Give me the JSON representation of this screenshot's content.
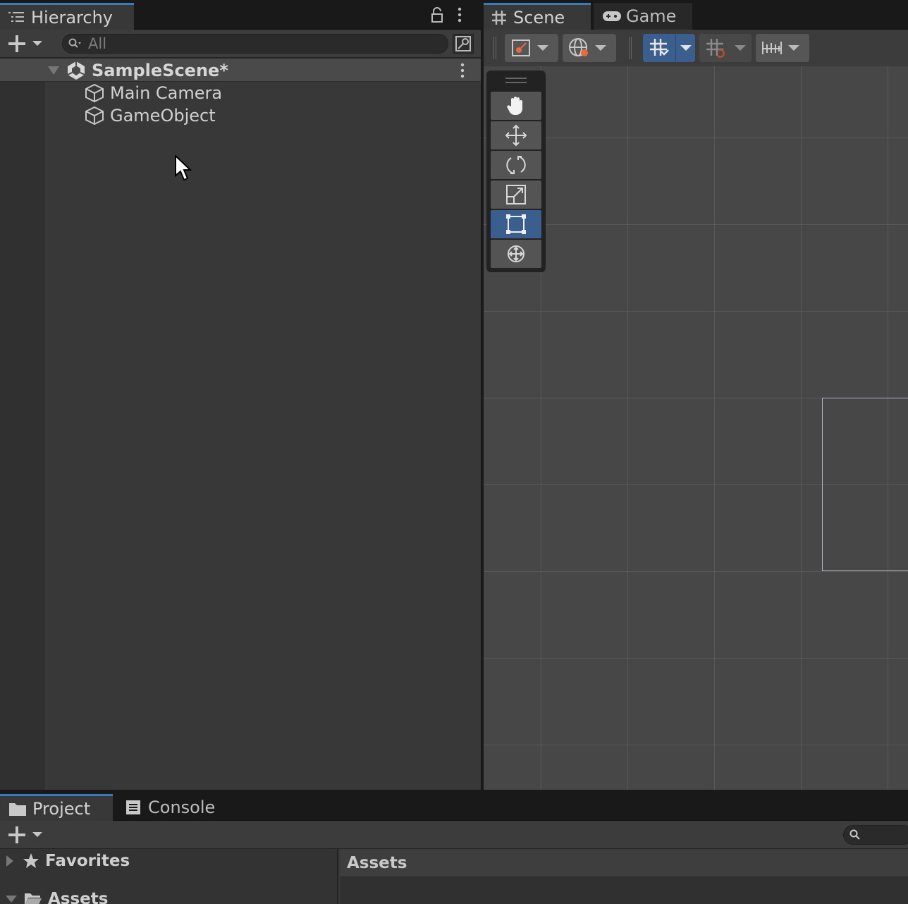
{
  "hierarchy": {
    "tab_label": "Hierarchy",
    "search_placeholder": "All",
    "scene_name": "SampleScene*",
    "items": [
      {
        "label": "Main Camera"
      },
      {
        "label": "GameObject"
      }
    ]
  },
  "scene_view": {
    "tabs": [
      {
        "label": "Scene"
      },
      {
        "label": "Game"
      }
    ],
    "tools": [
      "hand-tool",
      "move-tool",
      "rotate-tool",
      "scale-tool",
      "rect-tool",
      "transform-tool"
    ],
    "active_tool": "rect-tool"
  },
  "project": {
    "tabs": [
      {
        "label": "Project"
      },
      {
        "label": "Console"
      }
    ],
    "favorites_label": "Favorites",
    "assets_label": "Assets",
    "assets_header": "Assets"
  },
  "colors": {
    "accent": "#3a79bb",
    "selected_tool": "#3a5f8f",
    "panel_bg": "#383838"
  }
}
